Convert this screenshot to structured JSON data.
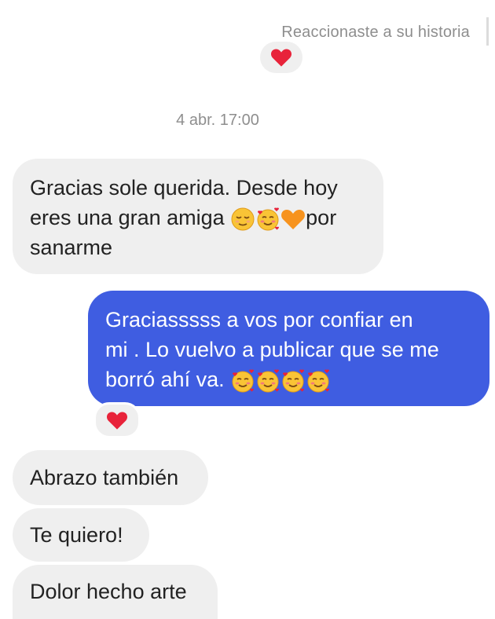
{
  "story": {
    "note": "Reaccionaste a su historia"
  },
  "timestamp": "4 abr. 17:00",
  "messages": [
    {
      "side": "in",
      "line1": "Gracias sole querida. Desde hoy",
      "line2a": "eres una gran amiga ",
      "line2b": "por",
      "line3": "sanarme"
    },
    {
      "side": "out",
      "line1": "Graciasssss  a vos por confiar en",
      "line2": "mi . Lo vuelvo a publicar que se me",
      "line3": "borró  ahí va. "
    },
    {
      "side": "in",
      "text": "Abrazo también"
    },
    {
      "side": "in",
      "text": "Te quiero!"
    },
    {
      "side": "in",
      "text": "Dolor hecho arte"
    }
  ],
  "icons": {
    "heart": "heart-icon",
    "relieved": "relieved-face-emoji",
    "hearts_face": "smiling-face-with-hearts-emoji",
    "orange_heart": "orange-heart-emoji"
  },
  "colors": {
    "outgoing": "#3f5de1",
    "incoming": "#efefef",
    "meta": "#8e8e8e",
    "heart": "#e8233a"
  }
}
